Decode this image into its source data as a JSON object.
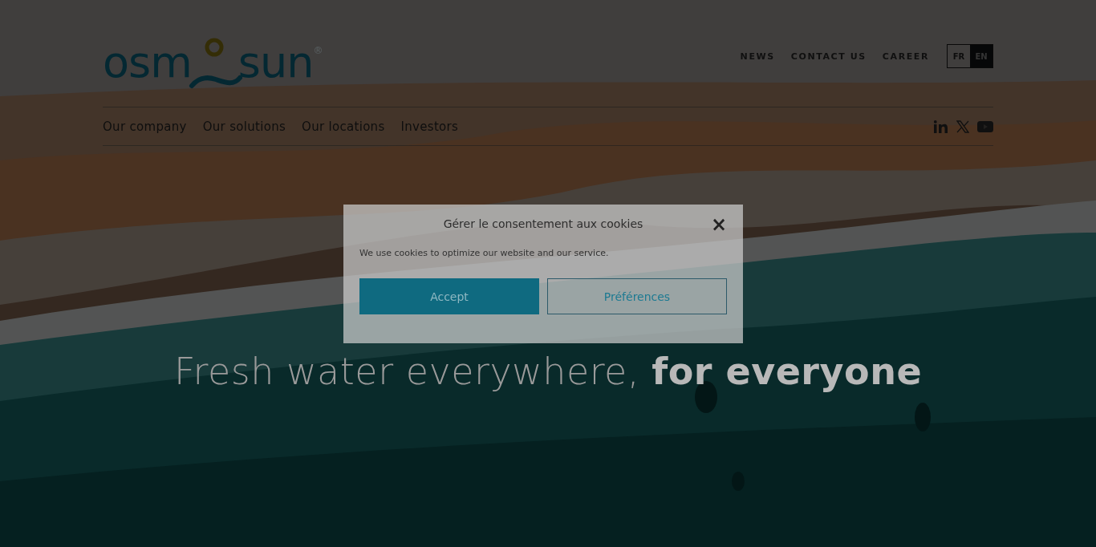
{
  "logo": {
    "left": "osm",
    "right": "sun",
    "mark": "®"
  },
  "top_links": [
    "NEWS",
    "CONTACT US",
    "CAREER"
  ],
  "languages": [
    {
      "label": "FR",
      "selected": false
    },
    {
      "label": "EN",
      "selected": true
    }
  ],
  "main_nav": [
    "Our company",
    "Our solutions",
    "Our locations",
    "Investors"
  ],
  "social": [
    {
      "kind": "linkedin"
    },
    {
      "kind": "x"
    },
    {
      "kind": "youtube"
    }
  ],
  "hero": {
    "heading": "Fresh water everywhere, **for everyone**"
  },
  "cookie_dialog": {
    "title": "Gérer le consentement aux cookies",
    "close": "×",
    "message": "We use cookies to optimize our website and our service.",
    "buttons": [
      {
        "label": "Accept",
        "kind": "primary"
      },
      {
        "label": "Préférences",
        "kind": "secondary"
      }
    ]
  }
}
